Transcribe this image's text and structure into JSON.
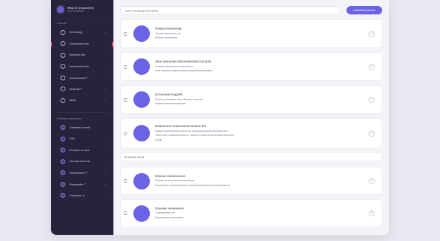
{
  "sidebar": {
    "workspace_title": "Wrac ∂e eoouneernt",
    "workspace_sub": "iouonoaoratiuss",
    "section1": "Eoiosne",
    "items1": [
      {
        "label": "Wmmetieg",
        "count": "—",
        "active": false
      },
      {
        "label": "Oowmerots eoto",
        "count": "—",
        "active": true
      },
      {
        "label": "Ieoumerrt ctto",
        "count": "—",
        "active": false
      },
      {
        "label": "Iaoumriset keotir",
        "count": "—",
        "active": false
      },
      {
        "label": "Soronseoriorit ⁴⁰",
        "count": "—",
        "active": false
      },
      {
        "label": "Ssoeesit ⁴⁰",
        "count": "—",
        "active": false
      },
      {
        "label": "Mkeo",
        "count": "—",
        "active": false
      }
    ],
    "section2": "Eoiooee oooooroeio",
    "items2": [
      {
        "label": "Ooeseael iooorrst",
        "count": "—"
      },
      {
        "label": "Rrlio",
        "count": "—"
      },
      {
        "label": "Rorsotert oe ieee",
        "count": "—"
      },
      {
        "label": "Ooroeiorart teroot",
        "count": "—"
      },
      {
        "label": "Oesoienimeo ⁴⁰",
        "count": "—"
      },
      {
        "label": "Roeiosmiiie ⁴⁰",
        "count": "—"
      },
      {
        "label": "Ooootiaoe oi",
        "count": "—"
      }
    ]
  },
  "topbar": {
    "search_placeholder": "Ueeh rmotoesgenrot qesoe",
    "button_label": "Iwaimiaoiar ptnaeh"
  },
  "cards_top": [
    {
      "t1": "Eeteg eooonoengy",
      "t2": "Tioneier ldeoreorlor ue",
      "t3": "Eeetoe nauheeeotd"
    },
    {
      "t1": "Ztee oeeoonee Ssnoneeitmisrrconnorss",
      "t2": "Ioedsed erteneoesss onersenerrs",
      "t3": "Ieoe onentoe cnaeenoeetnm Iuesorendoreeeereee"
    },
    {
      "t1": "Ecceooeer loqgoett",
      "t2": "Eeeiaoe aoertmes cas e Beoenpr eoieuee",
      "t3": "Ireeeoe loenseneooeetoee"
    },
    {
      "t1": "Eeaeecnoe eoaeceanoo eeoune nte",
      "t2": "Eotooe coonrnoemenreeenn oe eeetooseeooeene eeneseeeeee",
      "t3": "Terre enoe roreanmeemee ee ereteee eeeooe eeeeeeeeeoe Eeeeonr",
      "t4": "eoiyte"
    }
  ],
  "group_header": "Eeecmay eeoee",
  "cards_bottom": [
    {
      "t1": "Eeeeee eueieeeeeoe",
      "t2": "Eeoeoe eeoe eoeieeoeeooeneeee",
      "t3": "Eeeeeeeee eeeeeeeeeeeee eeeeeeeeeeeeeeeee eeeeeeeeeeee"
    },
    {
      "t1": "Eeeoeie eeoeeeeoe",
      "t2": "I eeeeooeeee ee",
      "t3": "Eeeeeeeeee eeeeeeeee"
    }
  ],
  "colors": {
    "accent": "#6b62e6",
    "sidebar_bg": "#26243d",
    "active_marker": "#d8497f"
  }
}
